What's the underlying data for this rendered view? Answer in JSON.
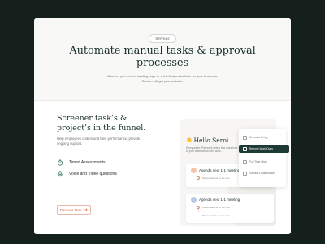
{
  "hero": {
    "badge": "Services",
    "title": "Automate manual tasks & approval processes",
    "subtitle": "Whether you need a landing page or a full-fledged website for your business, Cartem will get your website."
  },
  "section": {
    "title": "Screener task’s & project’s in the funnel.",
    "description": "Help employees understand their performance, provide ongoing support.",
    "features": [
      {
        "icon": "stopwatch-icon",
        "label": "Timed Assessments"
      },
      {
        "icon": "microphone-icon",
        "label": "Voice and Video questions"
      }
    ],
    "cta_label": "Discover Now"
  },
  "mockup": {
    "greeting": "Hello Seroi",
    "greeting_emoji": "👋",
    "description": "Every week, Pipework sets a few questions to your team about their work.",
    "agenda_cards": [
      {
        "title": "Agenda next 1-1 meeting",
        "item": "Please tasazne on the new"
      },
      {
        "title": "Agenda next 1-1 meeting",
        "item": "Please tasazne on the new"
      }
    ],
    "second_card_extra_item": "Please tasazne on the new",
    "menu": [
      {
        "label": "Onboard Hiring",
        "active": false
      },
      {
        "label": "Remote Work Ques",
        "active": true
      },
      {
        "label": "Full Time Work",
        "active": false
      },
      {
        "label": "Simulat Collaboration",
        "active": false
      }
    ]
  },
  "colors": {
    "background": "#15201d",
    "heading": "#18302a",
    "accent": "#d35d35",
    "menu_active": "#1d3a34"
  }
}
